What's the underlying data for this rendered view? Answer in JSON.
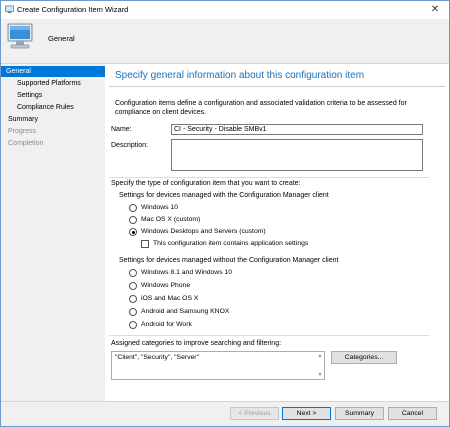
{
  "window": {
    "title": "Create Configuration Item Wizard",
    "close_glyph": "✕"
  },
  "banner": {
    "title": "General",
    "icon": "computer-icon"
  },
  "nav": {
    "items": [
      {
        "label": "General",
        "state": "active"
      },
      {
        "label": "Supported Platforms",
        "state": "normal"
      },
      {
        "label": "Settings",
        "state": "normal"
      },
      {
        "label": "Compliance Rules",
        "state": "normal"
      },
      {
        "label": "Summary",
        "state": "normal"
      },
      {
        "label": "Progress",
        "state": "disabled"
      },
      {
        "label": "Completion",
        "state": "disabled"
      }
    ]
  },
  "main": {
    "heading": "Specify general information about this configuration item",
    "intro": "Configuration items define a configuration and associated validation criteria to be assessed for compliance on client devices.",
    "name_label": "Name:",
    "name_value": "CI - Security - Disable SMBv1",
    "description_label": "Description:",
    "description_value": "",
    "type_prompt": "Specify the type of configuration item that you want to create:",
    "managed_group_label": "Settings for devices managed with the Configuration Manager client",
    "managed_options": [
      {
        "label": "Windows 10",
        "checked": false
      },
      {
        "label": "Mac OS X (custom)",
        "checked": false
      },
      {
        "label": "Windows Desktops and Servers (custom)",
        "checked": true
      }
    ],
    "app_settings_checkbox": {
      "label": "This configuration item contains application settings",
      "checked": false
    },
    "unmanaged_group_label": "Settings for devices managed without the Configuration Manager client",
    "unmanaged_options": [
      {
        "label": "Windows 8.1 and Windows 10",
        "checked": false
      },
      {
        "label": "Windows Phone",
        "checked": false
      },
      {
        "label": "iOS and Mac OS X",
        "checked": false
      },
      {
        "label": "Android and Samsung KNOX",
        "checked": false
      },
      {
        "label": "Android for Work",
        "checked": false
      }
    ],
    "categories_label": "Assigned categories to improve searching and filtering:",
    "categories_value": "\"Client\", \"Security\", \"Server\"",
    "categories_button": "Categories..."
  },
  "footer": {
    "previous": "< Previous",
    "next": "Next >",
    "summary": "Summary",
    "cancel": "Cancel"
  },
  "colors": {
    "accent": "#0078d7",
    "heading": "#1f6fb6"
  }
}
